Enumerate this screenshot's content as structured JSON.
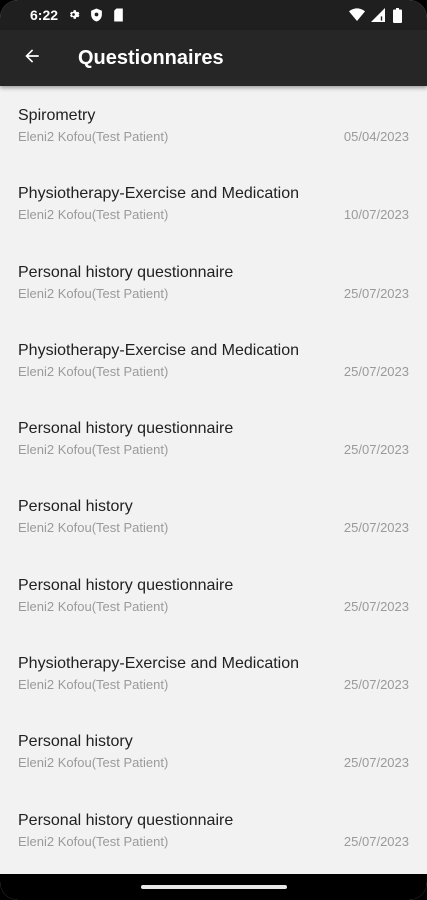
{
  "status_bar": {
    "time": "6:22",
    "left_icons": [
      "settings-icon",
      "shield-icon",
      "sim-card-icon"
    ],
    "right_icons": [
      "wifi-icon",
      "signal-icon",
      "battery-icon"
    ]
  },
  "app_bar": {
    "back_icon": "arrow-left-icon",
    "title": "Questionnaires"
  },
  "list": {
    "items": [
      {
        "title": "Spirometry",
        "patient": "Eleni2 Kofou(Test Patient)",
        "date": "05/04/2023"
      },
      {
        "title": "Physiotherapy-Exercise and Medication",
        "patient": "Eleni2 Kofou(Test Patient)",
        "date": "10/07/2023"
      },
      {
        "title": "Personal history questionnaire",
        "patient": "Eleni2 Kofou(Test Patient)",
        "date": "25/07/2023"
      },
      {
        "title": "Physiotherapy-Exercise and Medication",
        "patient": "Eleni2 Kofou(Test Patient)",
        "date": "25/07/2023"
      },
      {
        "title": "Personal history questionnaire",
        "patient": "Eleni2 Kofou(Test Patient)",
        "date": "25/07/2023"
      },
      {
        "title": "Personal history",
        "patient": "Eleni2 Kofou(Test Patient)",
        "date": "25/07/2023"
      },
      {
        "title": "Personal history questionnaire",
        "patient": "Eleni2 Kofou(Test Patient)",
        "date": "25/07/2023"
      },
      {
        "title": "Physiotherapy-Exercise and Medication",
        "patient": "Eleni2 Kofou(Test Patient)",
        "date": "25/07/2023"
      },
      {
        "title": "Personal history",
        "patient": "Eleni2 Kofou(Test Patient)",
        "date": "25/07/2023"
      },
      {
        "title": "Personal history questionnaire",
        "patient": "Eleni2 Kofou(Test Patient)",
        "date": "25/07/2023"
      }
    ]
  }
}
